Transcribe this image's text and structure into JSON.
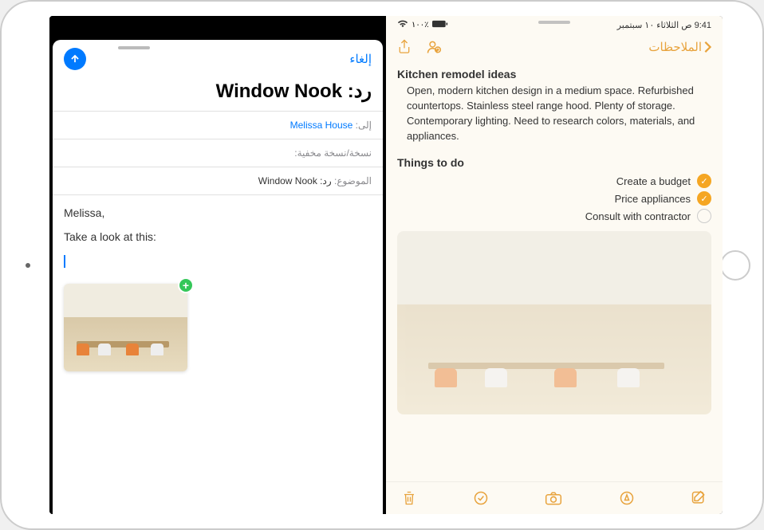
{
  "status": {
    "time_date": "9:41 ص  الثلاثاء ١٠ سبتمبر",
    "battery_pct": "١٠٠٪"
  },
  "notes": {
    "back_label": "الملاحظات",
    "title": "Kitchen remodel ideas",
    "body": "Open, modern kitchen design in a medium space. Refurbished countertops. Stainless steel range hood. Plenty of storage. Contemporary lighting. Need to research colors, materials, and appliances.",
    "todo_title": "Things to do",
    "todos": [
      {
        "label": "Create a budget",
        "checked": true
      },
      {
        "label": "Price appliances",
        "checked": true
      },
      {
        "label": "Consult with contractor",
        "checked": false
      }
    ]
  },
  "mail": {
    "cancel": "إلغاء",
    "subject_header": "رد: Window Nook",
    "to_label": "إلى:",
    "to_value": "Melissa House",
    "cc_label": "نسخة/نسخة مخفية:",
    "subject_prefix": "الموضوع:",
    "subject_full": "رد: Window Nook",
    "body_line1": "Melissa,",
    "body_line2": "Take a look at this:",
    "add_badge": "+"
  }
}
